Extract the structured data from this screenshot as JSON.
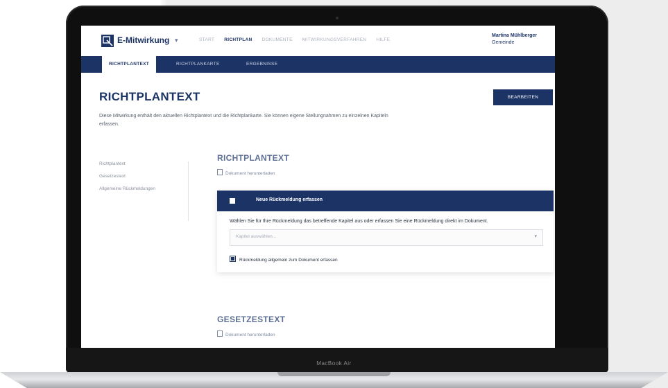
{
  "header": {
    "logo_text": "E-Mitwirkung",
    "logo_caret": "▾",
    "nav": [
      {
        "label": "START"
      },
      {
        "label": "RICHTPLAN"
      },
      {
        "label": "DOKUMENTE"
      },
      {
        "label": "MITWIRKUNGSVERFAHREN"
      },
      {
        "label": "HILFE"
      }
    ],
    "user_name": "Martina Mühlberger",
    "user_role": "Gemeinde"
  },
  "subnav": {
    "tabs": [
      {
        "label": "RICHTPLANTEXT"
      },
      {
        "label": "RICHTPLANKARTE"
      },
      {
        "label": "ERGEBNISSE"
      }
    ]
  },
  "page": {
    "title": "RICHTPLANTEXT",
    "edit_button": "BEARBEITEN",
    "intro": "Diese Mitwirkung enthält den aktuellen Richtplantext und die Richtplankarte. Sie können eigene Stellungnahmen zu einzelnen Kapiteln erfassen."
  },
  "sidenav": {
    "items": [
      {
        "label": "Richtplantext"
      },
      {
        "label": "Gesetzestext"
      },
      {
        "label": "Allgemeine Rückmeldungen"
      }
    ]
  },
  "section1": {
    "title": "RICHTPLANTEXT",
    "link": "Dokument herunterladen"
  },
  "card": {
    "header": "Neue Rückmeldung erfassen",
    "question": "Wählen Sie für Ihre Rückmeldung das betreffende Kapitel aus oder erfassen Sie eine Rückmeldung direkt im Dokument.",
    "select_placeholder": "Kapitel auswählen...",
    "checkbox_label": "Rückmeldung allgemein zum Dokument erfassen"
  },
  "section2": {
    "title": "GESETZESTEXT",
    "link": "Dokument herunterladen"
  },
  "device": {
    "brand_label": "MacBook Air"
  }
}
